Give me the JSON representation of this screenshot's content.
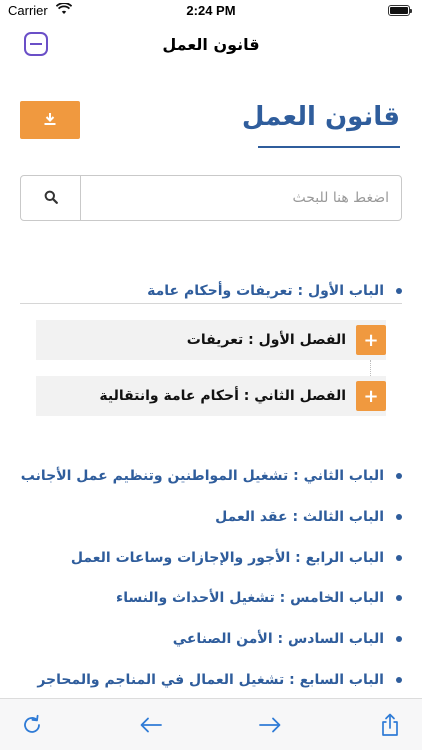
{
  "status_bar": {
    "carrier": "Carrier",
    "time": "2:24 PM"
  },
  "nav": {
    "title": "قانون العمل",
    "menu_icon": "menu-icon"
  },
  "header": {
    "title": "قانون العمل",
    "download_icon": "download-icon"
  },
  "search": {
    "placeholder": "اضغط هنا للبحث",
    "value": "",
    "icon": "search-icon"
  },
  "parts": [
    {
      "label": "الباب الأول : تعريفات وأحكام عامة",
      "expanded": true,
      "chapters": [
        {
          "label": "الفصل الأول : تعريفات"
        },
        {
          "label": "الفصل الثاني : أحكام عامة وانتقالية"
        }
      ]
    },
    {
      "label": "الباب الثاني : تشغيل المواطنين وتنظيم عمل الأجانب"
    },
    {
      "label": "الباب الثالث : عقد العمل"
    },
    {
      "label": "الباب الرابع : الأجور والإجازات وساعات العمل"
    },
    {
      "label": "الباب الخامس : تشغيل الأحداث والنساء"
    },
    {
      "label": "الباب السادس : الأمن الصناعي"
    },
    {
      "label": "الباب السابع : تشغيل العمال في المناجم والمحاجر"
    }
  ],
  "chapter_expand_symbol": "+",
  "toolbar": {
    "icons": [
      "refresh-icon",
      "back-icon",
      "forward-icon",
      "share-icon"
    ]
  },
  "colors": {
    "accent_orange": "#f0993f",
    "primary_blue": "#2f5d9c",
    "menu_purple": "#6a4fc7",
    "toolbar_blue": "#2f7bd6"
  }
}
